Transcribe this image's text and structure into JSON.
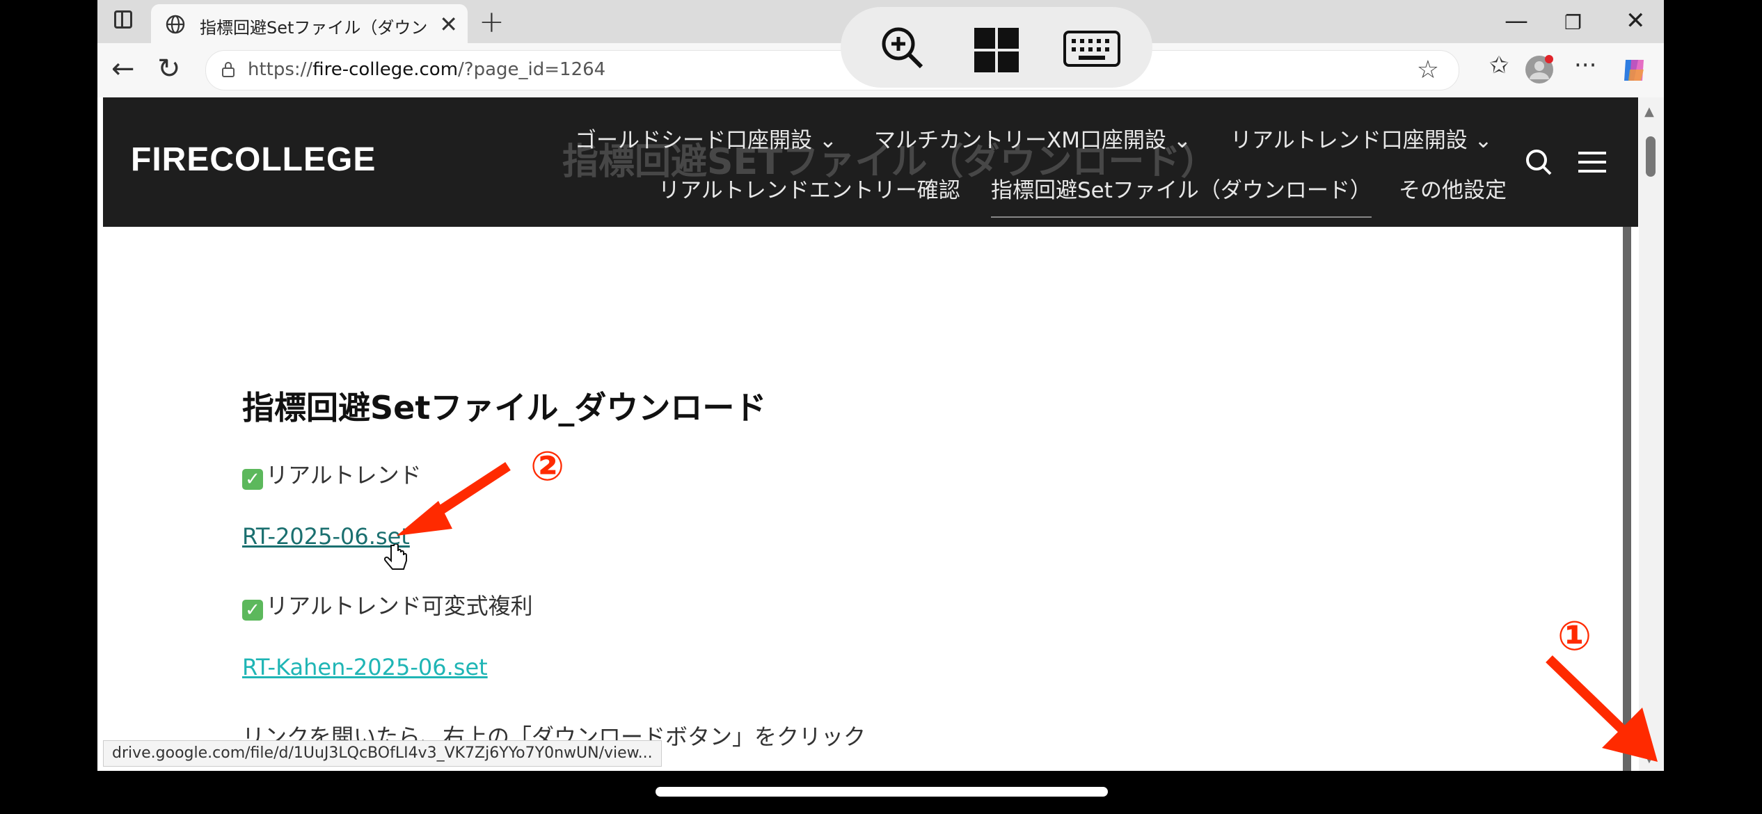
{
  "tab": {
    "title": "指標回避Setファイル（ダウンロード）"
  },
  "address": {
    "prefix": "https://",
    "domain": "fire-college.com",
    "path": "/?page_id=1264"
  },
  "site": {
    "logo": "FIRECOLLEGE",
    "ghost_title": "指標回避SETファイル（ダウンロード）",
    "menu": [
      "ゴールドシード口座開設 ⌄",
      "マルチカントリーXM口座開設 ⌄",
      "リアルトレンド口座開設 ⌄",
      "リアルトレンドエントリー確認",
      "指標回避Setファイル（ダウンロード）",
      "その他設定"
    ]
  },
  "article": {
    "heading": "指標回避Setファイル_ダウンロード",
    "section1": "リアルトレンド",
    "link1": "RT-2025-06.set",
    "section2": "リアルトレンド可変式複利",
    "link2": "RT-Kahen-2025-06.set",
    "note": "リンクを開いたら、右上の「ダウンロードボタン」をクリック"
  },
  "status_url": "drive.google.com/file/d/1UuJ3LQcBOfLI4v3_VK7Zj6YYo7Y0nwUN/view...",
  "annotations": {
    "one": "①",
    "two": "②"
  },
  "colors": {
    "header_bg": "#1e1e1e",
    "link1": "#1a6f6f",
    "link2": "#1fb5b5",
    "arrow": "#ff2a00"
  }
}
